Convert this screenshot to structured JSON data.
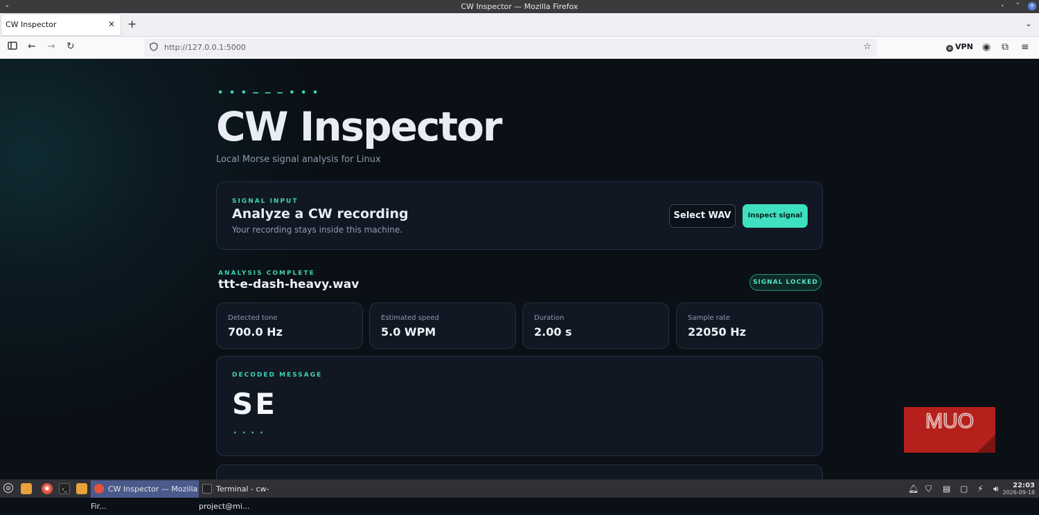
{
  "window": {
    "title": "CW Inspector — Mozilla Firefox"
  },
  "browser": {
    "tab_title": "CW Inspector",
    "url": "http://127.0.0.1:5000",
    "vpn_label": "VPN"
  },
  "page": {
    "morse_header": "• • •  ‒ ‒ ‒  • • •",
    "title": "CW Inspector",
    "subtitle": "Local Morse signal analysis for Linux",
    "input_card": {
      "kicker": "SIGNAL INPUT",
      "heading": "Analyze a CW recording",
      "hint": "Your recording stays inside this machine.",
      "select_button": "Select WAV",
      "inspect_button": "Inspect signal"
    },
    "result": {
      "kicker": "ANALYSIS COMPLETE",
      "filename": "ttt-e-dash-heavy.wav",
      "badge": "SIGNAL LOCKED",
      "stats": [
        {
          "label": "Detected tone",
          "value": "700.0 Hz"
        },
        {
          "label": "Estimated speed",
          "value": "5.0 WPM"
        },
        {
          "label": "Duration",
          "value": "2.00 s"
        },
        {
          "label": "Sample rate",
          "value": "22050 Hz"
        }
      ],
      "decoded": {
        "kicker": "DECODED MESSAGE",
        "message": "SE",
        "morse": "· · ·  ·"
      }
    }
  },
  "watermark": {
    "text": "MUO"
  },
  "taskbar": {
    "firefox_item": "CW Inspector — Mozilla Fir...",
    "terminal_item": "Terminal - cw-project@mi...",
    "time": "22:03",
    "date": "2026-09-18"
  },
  "colors": {
    "accent": "#3fe0c0",
    "page_bg": "#0b1017",
    "card_bg": "#111824",
    "watermark_red": "#b5201c"
  }
}
